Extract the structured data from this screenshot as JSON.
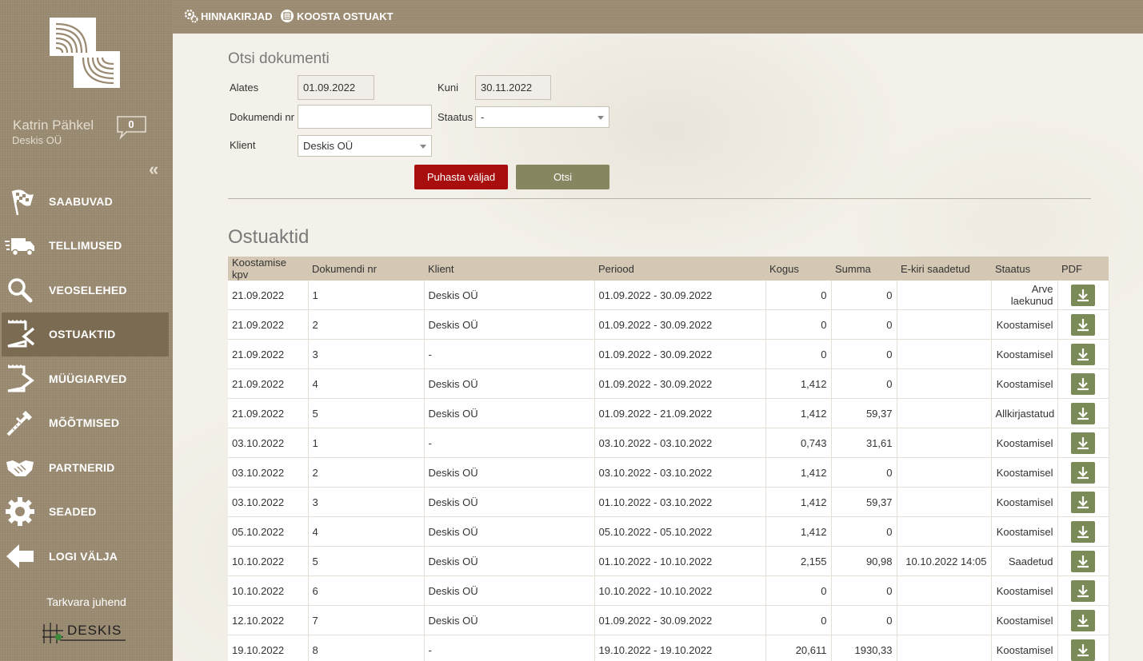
{
  "sidebar": {
    "user_name": "Katrin Pähkel",
    "company": "Deskis OÜ",
    "message_count": "0",
    "collapse_icon": "«",
    "items": [
      {
        "label": "SAABUVAD",
        "icon": "checkered-flag-icon"
      },
      {
        "label": "TELLIMUSED",
        "icon": "truck-icon"
      },
      {
        "label": "VEOSELEHED",
        "icon": "magnifier-icon"
      },
      {
        "label": "OSTUAKTID",
        "icon": "document-arrow-in-icon",
        "active": true
      },
      {
        "label": "MÜÜGIARVED",
        "icon": "document-arrow-out-icon"
      },
      {
        "label": "MÕÕTMISED",
        "icon": "caliper-icon"
      },
      {
        "label": "PARTNERID",
        "icon": "handshake-icon"
      },
      {
        "label": "SEADED",
        "icon": "gear-icon"
      },
      {
        "label": "LOGI VÄLJA",
        "icon": "arrow-left-icon"
      }
    ],
    "guide_link": "Tarkvara juhend",
    "brand": "DESKIS"
  },
  "topbar": {
    "price_lists": "HINNAKIRJAD",
    "create_act": "KOOSTA OSTUAKT"
  },
  "search": {
    "title": "Otsi dokumenti",
    "from_label": "Alates",
    "from_value": "01.09.2022",
    "to_label": "Kuni",
    "to_value": "30.11.2022",
    "docnr_label": "Dokumendi nr",
    "docnr_value": "",
    "status_label": "Staatus",
    "status_value": "-",
    "client_label": "Klient",
    "client_value": "Deskis OÜ",
    "clear_button": "Puhasta väljad",
    "search_button": "Otsi"
  },
  "results": {
    "title": "Ostuaktid",
    "columns": [
      "Koostamise kpv",
      "Dokumendi nr",
      "Klient",
      "Periood",
      "Kogus",
      "Summa",
      "E-kiri saadetud",
      "Staatus",
      "PDF"
    ],
    "rows": [
      {
        "date": "21.09.2022",
        "nr": "1",
        "client": "Deskis OÜ",
        "period": "01.09.2022 - 30.09.2022",
        "qty": "0",
        "sum": "0",
        "email": "",
        "status": "Arve laekunud"
      },
      {
        "date": "21.09.2022",
        "nr": "2",
        "client": "Deskis OÜ",
        "period": "01.09.2022 - 30.09.2022",
        "qty": "0",
        "sum": "0",
        "email": "",
        "status": "Koostamisel"
      },
      {
        "date": "21.09.2022",
        "nr": "3",
        "client": "-",
        "period": "01.09.2022 - 30.09.2022",
        "qty": "0",
        "sum": "0",
        "email": "",
        "status": "Koostamisel"
      },
      {
        "date": "21.09.2022",
        "nr": "4",
        "client": "Deskis OÜ",
        "period": "01.09.2022 - 30.09.2022",
        "qty": "1,412",
        "sum": "0",
        "email": "",
        "status": "Koostamisel"
      },
      {
        "date": "21.09.2022",
        "nr": "5",
        "client": "Deskis OÜ",
        "period": "01.09.2022 - 21.09.2022",
        "qty": "1,412",
        "sum": "59,37",
        "email": "",
        "status": "Allkirjastatud"
      },
      {
        "date": "03.10.2022",
        "nr": "1",
        "client": "-",
        "period": "03.10.2022 - 03.10.2022",
        "qty": "0,743",
        "sum": "31,61",
        "email": "",
        "status": "Koostamisel"
      },
      {
        "date": "03.10.2022",
        "nr": "2",
        "client": "Deskis OÜ",
        "period": "03.10.2022 - 03.10.2022",
        "qty": "1,412",
        "sum": "0",
        "email": "",
        "status": "Koostamisel"
      },
      {
        "date": "03.10.2022",
        "nr": "3",
        "client": "Deskis OÜ",
        "period": "01.10.2022 - 03.10.2022",
        "qty": "1,412",
        "sum": "59,37",
        "email": "",
        "status": "Koostamisel"
      },
      {
        "date": "05.10.2022",
        "nr": "4",
        "client": "Deskis OÜ",
        "period": "05.10.2022 - 05.10.2022",
        "qty": "1,412",
        "sum": "0",
        "email": "",
        "status": "Koostamisel"
      },
      {
        "date": "10.10.2022",
        "nr": "5",
        "client": "Deskis OÜ",
        "period": "01.10.2022 - 10.10.2022",
        "qty": "2,155",
        "sum": "90,98",
        "email": "10.10.2022 14:05",
        "status": "Saadetud"
      },
      {
        "date": "10.10.2022",
        "nr": "6",
        "client": "Deskis OÜ",
        "period": "10.10.2022 - 10.10.2022",
        "qty": "0",
        "sum": "0",
        "email": "",
        "status": "Koostamisel"
      },
      {
        "date": "12.10.2022",
        "nr": "7",
        "client": "Deskis OÜ",
        "period": "01.09.2022 - 30.09.2022",
        "qty": "0",
        "sum": "0",
        "email": "",
        "status": "Koostamisel"
      },
      {
        "date": "19.10.2022",
        "nr": "8",
        "client": "-",
        "period": "19.10.2022 - 19.10.2022",
        "qty": "20,611",
        "sum": "1930,33",
        "email": "",
        "status": "Koostamisel"
      }
    ]
  },
  "colors": {
    "sidebar_bg": "#9a8a71",
    "active_item": "#7b6b52",
    "table_header": "#d4c7b3",
    "clear_button": "#a80e0e",
    "search_button": "#868661",
    "download_button": "#7b8b57"
  }
}
